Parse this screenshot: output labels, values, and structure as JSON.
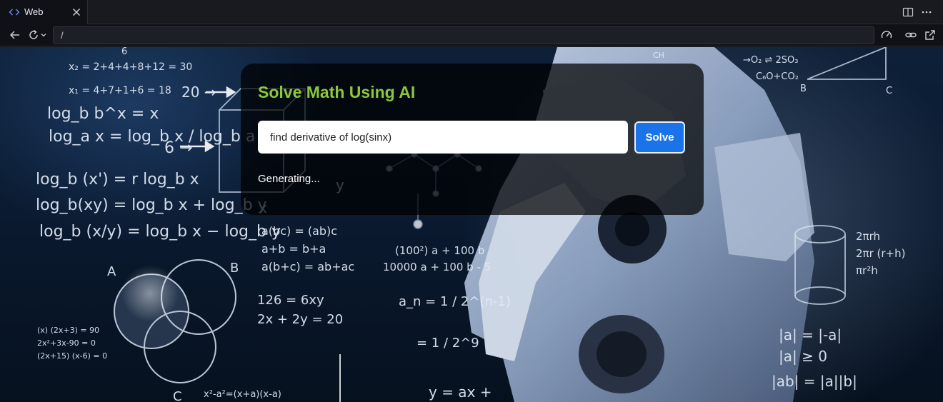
{
  "browser": {
    "tab": {
      "label": "Web",
      "icon": "code-icon"
    },
    "address": {
      "url": "/"
    },
    "icons": {
      "back": "arrow-left-icon",
      "reload": "reload-icon",
      "reload_menu": "chevron-down-icon",
      "split": "split-editor-icon",
      "more": "more-icon",
      "performance": "gauge-icon",
      "link": "link-icon",
      "open_external": "external-link-icon"
    }
  },
  "app": {
    "title": "Solve Math Using AI",
    "input": {
      "value": "find derivative of log(sinx)",
      "placeholder": ""
    },
    "solve_label": "Solve",
    "status": "Generating..."
  },
  "background": {
    "description_colors": {
      "accent": "#8bc83c",
      "button": "#1a73e8"
    },
    "formulas": [
      "6",
      "x₂ = 2+4+4+8+12 = 30",
      "x₁ = 4+7+1+6 = 18",
      "20 →",
      "log_b b^x = x",
      "log_a x = log_b x / log_b a",
      "6 →",
      "log_b (x') = r log_b x",
      "log_b(xy) = log_b x + log_b y",
      "log_b (x/y) = log_b x − log_b y",
      "A",
      "B",
      "C",
      "(x) (2x+3) = 90",
      "2x²+3x-90 = 0",
      "(2x+15) (x-6) = 0",
      "x²-a²=(x+a)(x-a)",
      "x",
      "y",
      "a(bc) = (ab)c",
      "a+b = b+a",
      "a(b+c) = ab+ac",
      "126  = 6xy",
      "2x + 2y = 20",
      "(100²) a + 100 b",
      "10000 a + 100 b - 5",
      "a_n = 1 / 2^(n-1)",
      "= 1 / 2^9",
      "y = ax +",
      "→O₂ ⇌ 2SO₃",
      "C₆O+CO₂",
      "CH",
      "B",
      "C",
      "2πrh",
      "2πr (r+h)",
      "πr²h",
      "|a| = |-a|",
      "|a| ≥ 0",
      "|ab| = |a||b|"
    ]
  }
}
